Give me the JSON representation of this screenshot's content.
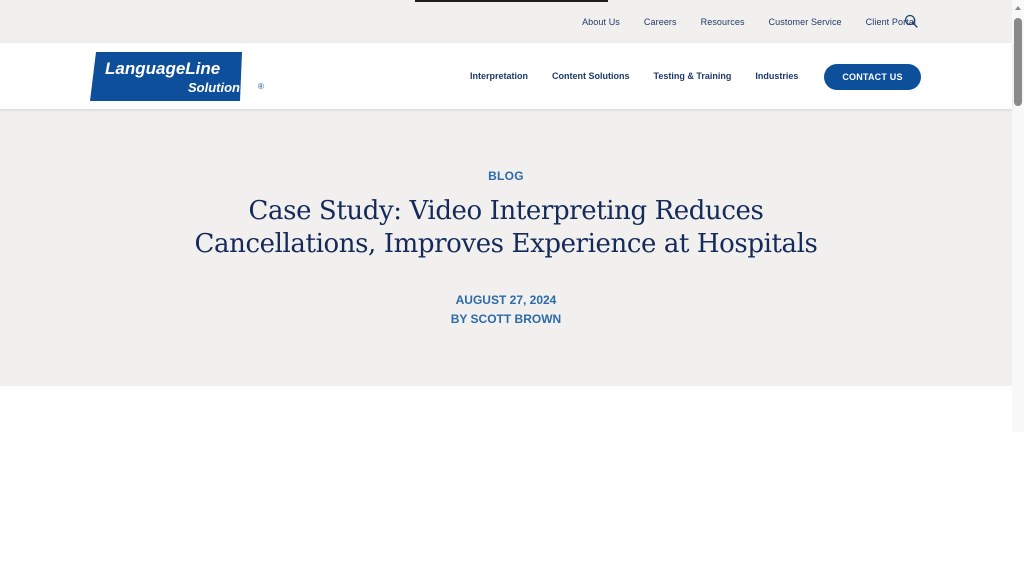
{
  "utility_nav": {
    "items": [
      "About Us",
      "Careers",
      "Resources",
      "Customer Service",
      "Client Portal"
    ],
    "search_icon": "search-icon"
  },
  "logo": {
    "line1": "LanguageLine",
    "line2": "Solutions",
    "mark": "®",
    "brand_color": "#0d4f9a"
  },
  "main_nav": {
    "items": [
      "Interpretation",
      "Content Solutions",
      "Testing & Training",
      "Industries"
    ],
    "cta_label": "CONTACT US"
  },
  "hero": {
    "category": "BLOG",
    "title_line1": "Case Study: Video Interpreting Reduces",
    "title_line2": "Cancellations, Improves Experience at Hospitals",
    "date": "AUGUST 27, 2024",
    "author": "BY SCOTT BROWN"
  },
  "colors": {
    "accent": "#0d4f9a",
    "heading": "#152a59",
    "meta": "#2c6aa8",
    "hero_bg": "#f1f0ef"
  }
}
